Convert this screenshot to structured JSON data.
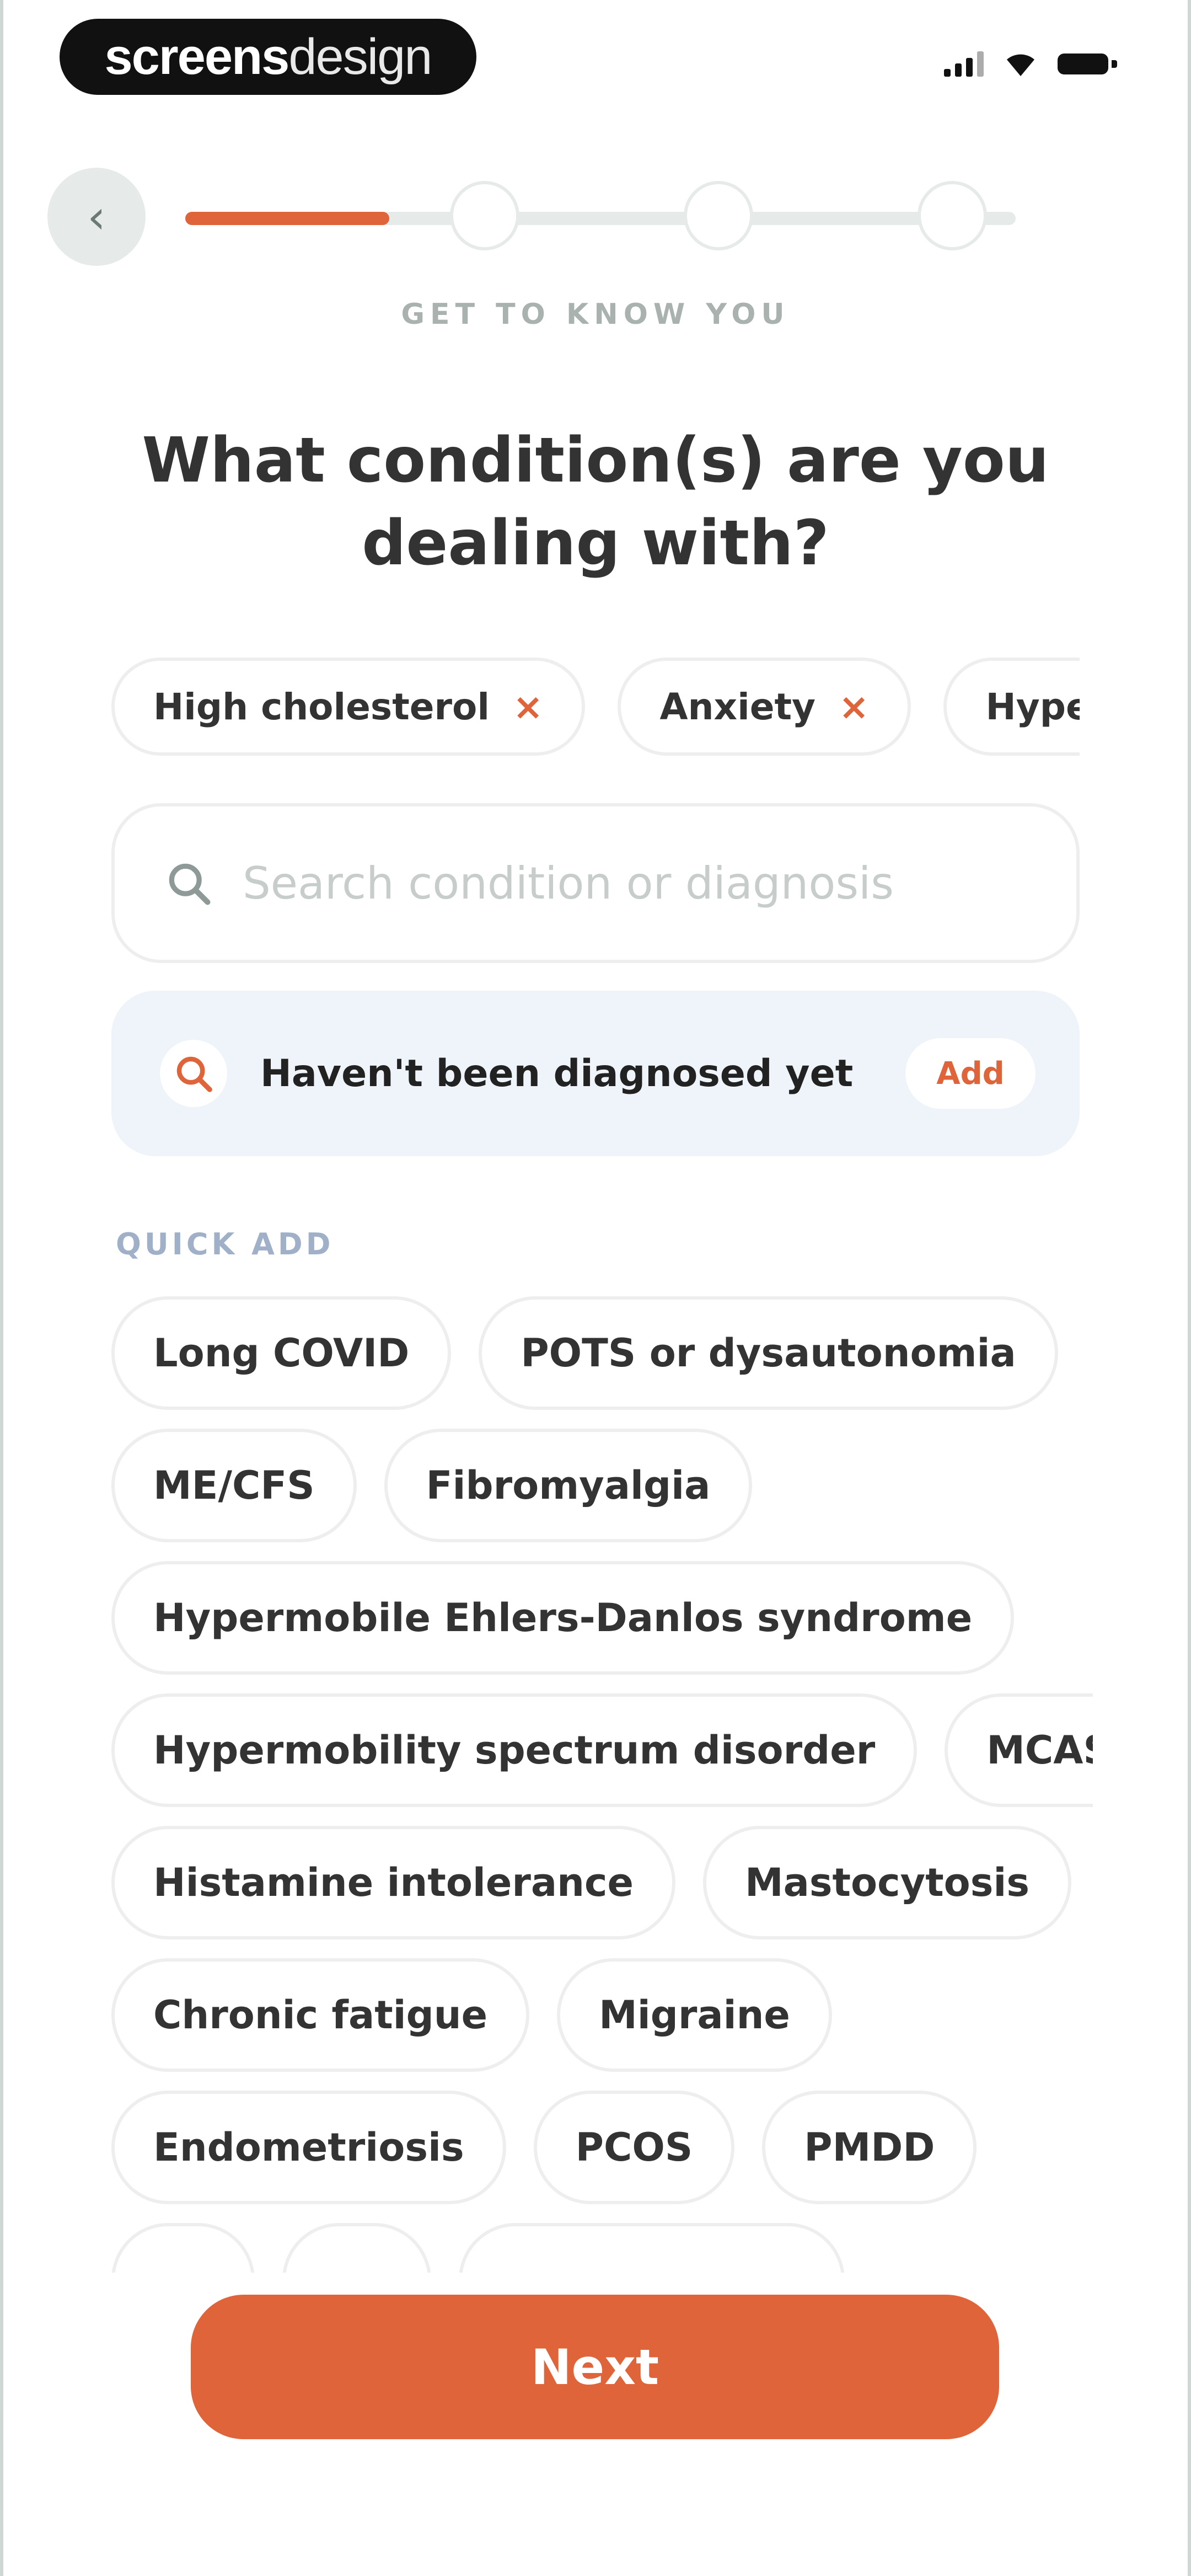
{
  "status_bar": {
    "brand_bold": "screens",
    "brand_light": "design",
    "signal_icon": "cellular-signal-icon",
    "wifi_icon": "wifi-icon",
    "battery_icon": "battery-icon"
  },
  "header": {
    "back_icon": "chevron-left-icon",
    "progress_fraction": 0.2,
    "step_label": "GET TO KNOW YOU"
  },
  "title": "What condition(s) are you dealing with?",
  "selected": [
    "High cholesterol",
    "Anxiety",
    "Hyperte"
  ],
  "remove_glyph": "×",
  "search": {
    "icon": "search-icon",
    "placeholder": "Search condition or diagnosis"
  },
  "undiagnosed": {
    "icon": "search-icon",
    "label": "Haven't been diagnosed yet",
    "add_label": "Add"
  },
  "quick_add": {
    "label": "QUICK ADD",
    "rows": [
      [
        "Long COVID",
        "POTS or dysautonomia"
      ],
      [
        "ME/CFS",
        "Fibromyalgia"
      ],
      [
        "Hypermobile Ehlers-Danlos syndrome"
      ],
      [
        "Hypermobility spectrum disorder",
        "MCAS"
      ],
      [
        "Histamine intolerance",
        "Mastocytosis"
      ],
      [
        "Chronic fatigue",
        "Migraine"
      ],
      [
        "Endometriosis",
        "PCOS",
        "PMDD"
      ]
    ]
  },
  "next_label": "Next",
  "colors": {
    "accent": "#e0643a",
    "chip_border": "#eeeeee",
    "muted_text": "#a9b2ae",
    "quick_add_label": "#9fb0c8",
    "undiagnosed_bg": "#eef4f9"
  }
}
